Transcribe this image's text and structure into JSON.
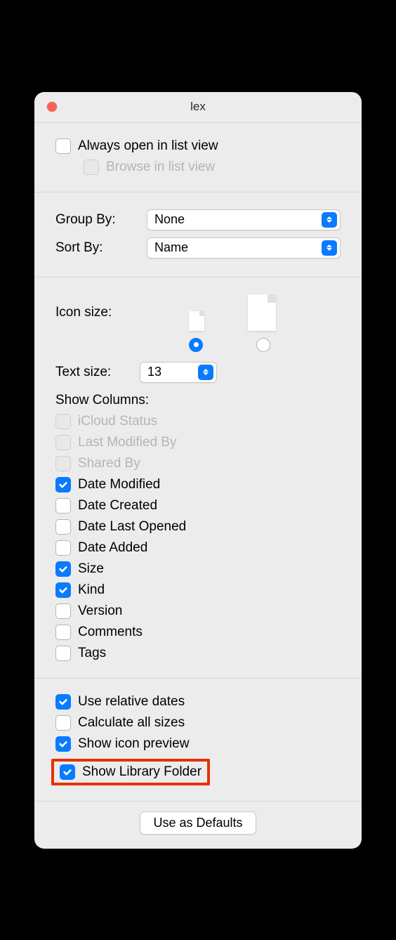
{
  "window": {
    "title": "lex"
  },
  "top": {
    "always_open": {
      "label": "Always open in list view",
      "checked": false,
      "disabled": false
    },
    "browse": {
      "label": "Browse in list view",
      "checked": false,
      "disabled": true
    }
  },
  "group_by": {
    "label": "Group By:",
    "value": "None"
  },
  "sort_by": {
    "label": "Sort By:",
    "value": "Name"
  },
  "icon_size": {
    "label": "Icon size:",
    "selected": "small"
  },
  "text_size": {
    "label": "Text size:",
    "value": "13"
  },
  "columns": {
    "header": "Show Columns:",
    "items": [
      {
        "label": "iCloud Status",
        "checked": false,
        "disabled": true
      },
      {
        "label": "Last Modified By",
        "checked": false,
        "disabled": true
      },
      {
        "label": "Shared By",
        "checked": false,
        "disabled": true
      },
      {
        "label": "Date Modified",
        "checked": true,
        "disabled": false
      },
      {
        "label": "Date Created",
        "checked": false,
        "disabled": false
      },
      {
        "label": "Date Last Opened",
        "checked": false,
        "disabled": false
      },
      {
        "label": "Date Added",
        "checked": false,
        "disabled": false
      },
      {
        "label": "Size",
        "checked": true,
        "disabled": false
      },
      {
        "label": "Kind",
        "checked": true,
        "disabled": false
      },
      {
        "label": "Version",
        "checked": false,
        "disabled": false
      },
      {
        "label": "Comments",
        "checked": false,
        "disabled": false
      },
      {
        "label": "Tags",
        "checked": false,
        "disabled": false
      }
    ]
  },
  "bottom": {
    "items": [
      {
        "label": "Use relative dates",
        "checked": true,
        "highlight": false
      },
      {
        "label": "Calculate all sizes",
        "checked": false,
        "highlight": false
      },
      {
        "label": "Show icon preview",
        "checked": true,
        "highlight": false
      },
      {
        "label": "Show Library Folder",
        "checked": true,
        "highlight": true
      }
    ]
  },
  "defaults_button": "Use as Defaults"
}
